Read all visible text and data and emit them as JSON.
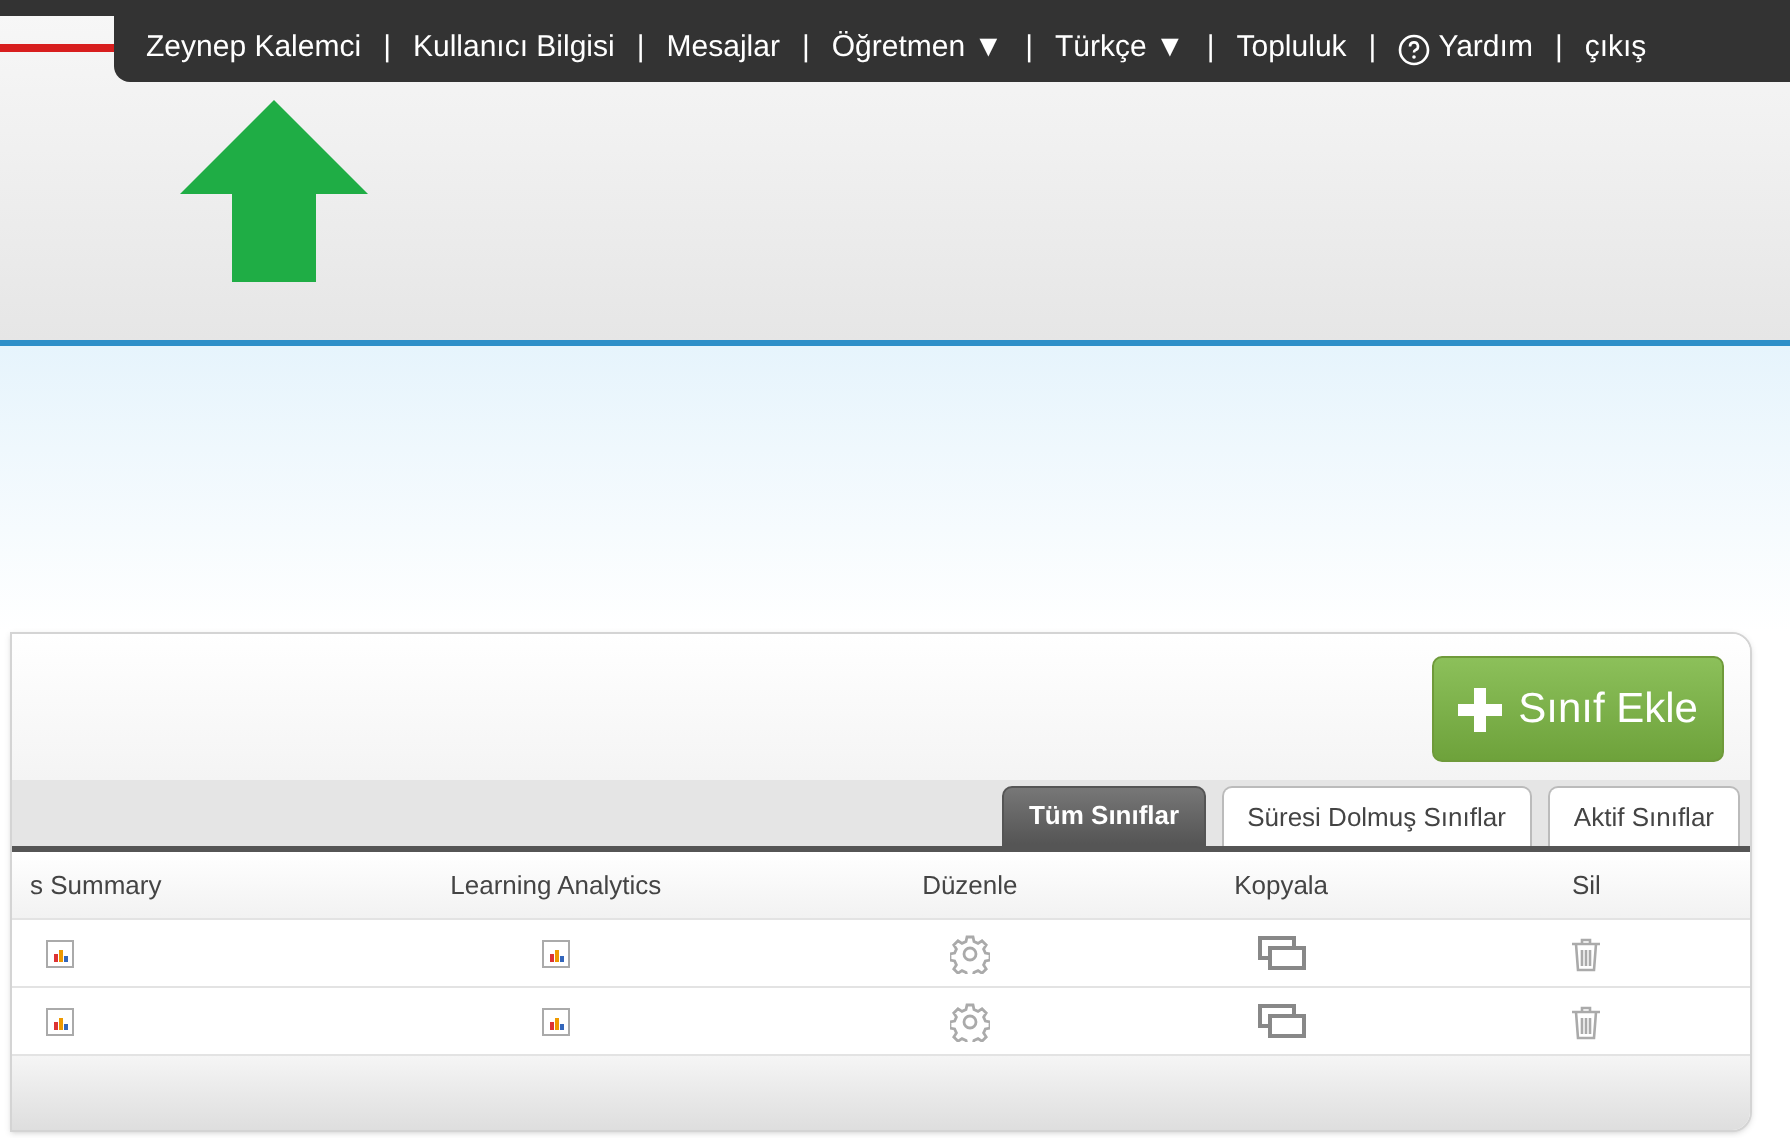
{
  "top_nav": [
    {
      "label": "Zeynep Kalemci",
      "kind": "link"
    },
    {
      "label": "|",
      "kind": "separator"
    },
    {
      "label": "Kullanıcı Bilgisi",
      "kind": "link"
    },
    {
      "label": "|",
      "kind": "separator"
    },
    {
      "label": "Mesajlar",
      "kind": "link"
    },
    {
      "label": "|",
      "kind": "separator"
    },
    {
      "label": "Öğretmen ▼",
      "kind": "link"
    },
    {
      "label": "|",
      "kind": "separator"
    },
    {
      "label": "Türkçe ▼",
      "kind": "link"
    },
    {
      "label": "|",
      "kind": "separator"
    },
    {
      "label": "Topluluk",
      "kind": "link"
    },
    {
      "label": "|",
      "kind": "separator"
    },
    {
      "label": "Yardım",
      "kind": "help"
    },
    {
      "label": "|",
      "kind": "separator"
    },
    {
      "label": "çıkış",
      "kind": "link"
    }
  ],
  "add_button": {
    "label": "Sınıf Ekle"
  },
  "tabs": [
    {
      "label": "Tüm Sınıflar",
      "selected": true
    },
    {
      "label": "Süresi Dolmuş Sınıflar",
      "selected": false
    },
    {
      "label": "Aktif Sınıflar",
      "selected": false
    }
  ],
  "table": {
    "columns": [
      {
        "label": "s Summary",
        "kind": "report"
      },
      {
        "label": "Learning Analytics",
        "kind": "report"
      },
      {
        "label": "Düzenle",
        "kind": "edit"
      },
      {
        "label": "Kopyala",
        "kind": "copy"
      },
      {
        "label": "Sil",
        "kind": "delete"
      }
    ]
  }
}
